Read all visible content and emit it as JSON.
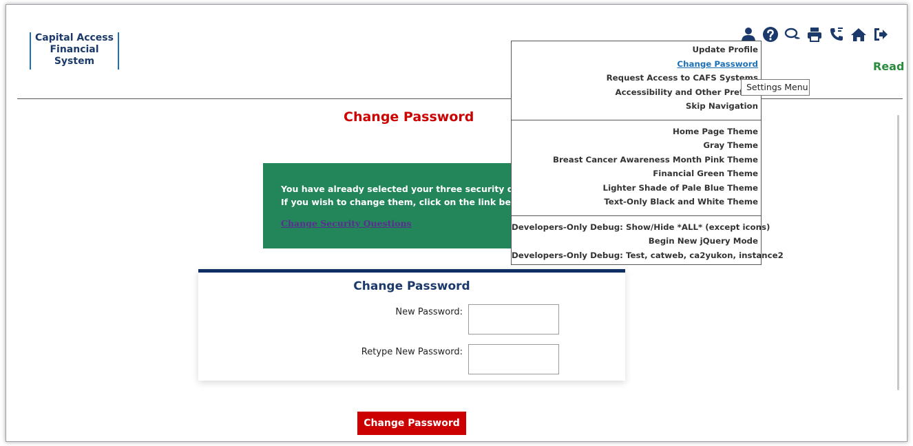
{
  "logo": {
    "line1": "Capital Access",
    "line2": "Financial",
    "line3": "System"
  },
  "header": {
    "status_text": "Read"
  },
  "toolbar": {
    "icons": [
      "user-icon",
      "help-icon",
      "chat-icon",
      "print-icon",
      "phone-icon",
      "home-icon",
      "logout-icon"
    ]
  },
  "page": {
    "title": "Change Password"
  },
  "notice": {
    "line1": "You have already selected your three security que",
    "line2": "If you wish to change them, click on the link below",
    "link_label": "Change Security Questions"
  },
  "form": {
    "title": "Change Password",
    "new_password_label": "New Password:",
    "retype_password_label": "Retype New Password:",
    "submit_label": "Change Password"
  },
  "settings_menu": {
    "group1": [
      "Update Profile",
      "Change Password",
      "Request Access to CAFS Systems",
      "Accessibility and Other Prefere",
      "Skip Navigation"
    ],
    "group2": [
      "Home Page Theme",
      "Gray Theme",
      "Breast Cancer Awareness Month Pink Theme",
      "Financial Green Theme",
      "Lighter Shade of Pale Blue Theme",
      "Text-Only Black and White Theme"
    ],
    "group3": [
      "Developers-Only Debug: Show/Hide *ALL* (except icons)",
      "Begin New jQuery Mode",
      "Developers-Only Debug: Test, catweb, ca2yukon, instance2"
    ]
  },
  "tooltip": {
    "text": "Settings Menu"
  },
  "colors": {
    "brand_navy": "#1b3a6b",
    "accent_red": "#cc0000",
    "notice_green": "#23855a",
    "link_blue": "#1a6fb5",
    "status_green": "#2a8a3e"
  }
}
